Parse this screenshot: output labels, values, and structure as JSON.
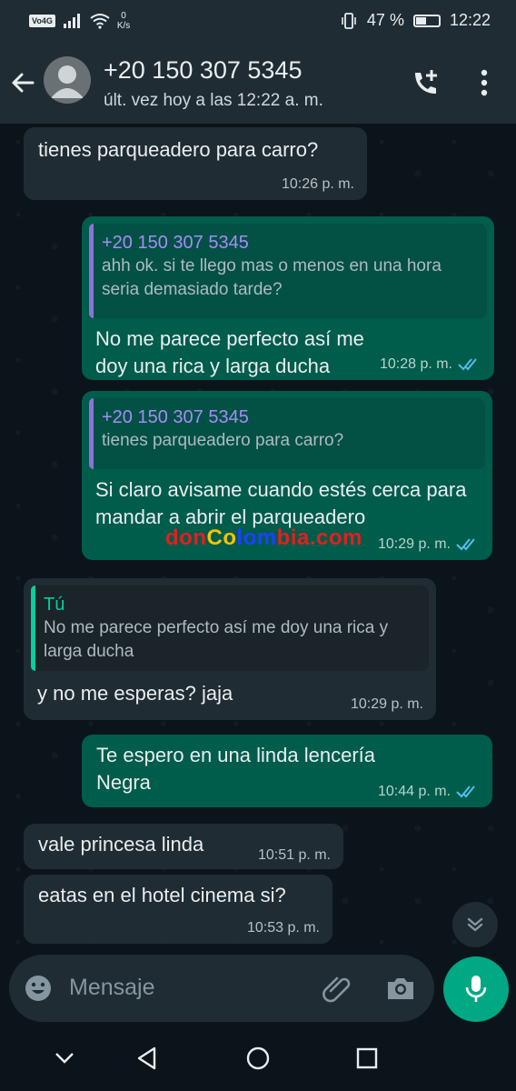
{
  "status_bar": {
    "network_badge": "Vo4G",
    "speed_value": "0",
    "speed_unit": "K/s",
    "battery": "47 %",
    "battery_level": 0.47,
    "time": "12:22"
  },
  "header": {
    "contact": "+20 150 307 5345",
    "last_seen": "últ. vez hoy a las 12:22 a. m."
  },
  "messages": [
    {
      "dir": "in",
      "text": "tienes parqueadero para carro?",
      "time": "10:26 p. m."
    },
    {
      "dir": "out",
      "quote_name": "+20 150 307 5345",
      "quote_text": "ahh ok. si te llego mas o menos en una hora seria demasiado tarde?",
      "text": "No me parece perfecto así me doy una rica y larga ducha",
      "time": "10:28 p. m."
    },
    {
      "dir": "out",
      "quote_name": "+20 150 307 5345",
      "quote_text": "tienes parqueadero para carro?",
      "text": "Si claro avisame cuando estés cerca para mandar a abrir el parqueadero",
      "time": "10:29 p. m."
    },
    {
      "dir": "in",
      "quote_name": "Tú",
      "quote_text": "No me parece perfecto así me doy una rica y larga ducha",
      "text": "y no me esperas? jaja",
      "time": "10:29 p. m."
    },
    {
      "dir": "out",
      "text": "Te espero en una linda lencería Negra",
      "time": "10:44 p. m."
    },
    {
      "dir": "in",
      "text": "vale princesa linda",
      "time": "10:51 p. m."
    },
    {
      "dir": "in",
      "text": "eatas en el hotel cinema si?",
      "time": "10:53 p. m."
    }
  ],
  "watermark": {
    "parts": [
      {
        "text": "don",
        "color": "#e02020"
      },
      {
        "text": "Co",
        "color": "#f5c400"
      },
      {
        "text": "lom",
        "color": "#1e40ff"
      },
      {
        "text": "bia.com",
        "color": "#e02020"
      }
    ]
  },
  "input": {
    "placeholder": "Mensaje"
  },
  "colors": {
    "incoming_bubble": "#202c33",
    "outgoing_bubble": "#005c4b",
    "accent": "#00a884",
    "read_ticks": "#53bdeb"
  }
}
